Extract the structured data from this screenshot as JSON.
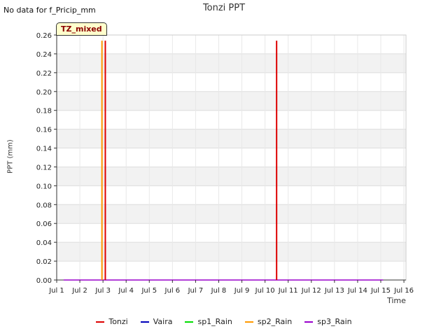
{
  "note": "No data for f_Pricip_mm",
  "badge": "TZ_mixed",
  "chart_data": {
    "type": "line",
    "title": "Tonzi PPT",
    "xlabel": "Time",
    "ylabel": "PPT (mm)",
    "xlim": [
      "2024-07-01",
      "2024-07-16"
    ],
    "ylim": [
      0,
      0.26
    ],
    "x_ticks": [
      "Jul 1",
      "Jul 2",
      "Jul 3",
      "Jul 4",
      "Jul 5",
      "Jul 6",
      "Jul 7",
      "Jul 8",
      "Jul 9",
      "Jul 10",
      "Jul 11",
      "Jul 12",
      "Jul 13",
      "Jul 14",
      "Jul 15",
      "Jul 16"
    ],
    "y_ticks": [
      "0.00",
      "0.02",
      "0.04",
      "0.06",
      "0.08",
      "0.10",
      "0.12",
      "0.14",
      "0.16",
      "0.18",
      "0.20",
      "0.22",
      "0.24",
      "0.26"
    ],
    "grid": true,
    "legend_position": "bottom",
    "series": [
      {
        "name": "Tonzi",
        "color": "#dd0000",
        "x": [
          "Jul 1.3",
          "Jul 3.1",
          "Jul 10.5",
          "Jul 15.1"
        ],
        "y": [
          0,
          0.254,
          0.254,
          0
        ]
      },
      {
        "name": "Vaira",
        "color": "#0000bb",
        "x": [],
        "y": []
      },
      {
        "name": "sp1_Rain",
        "color": "#00dd00",
        "x": [],
        "y": []
      },
      {
        "name": "sp2_Rain",
        "color": "#ff9900",
        "x": [
          "Jul 3.0"
        ],
        "y": [
          0.254
        ]
      },
      {
        "name": "sp3_Rain",
        "color": "#9900cc",
        "x": [
          "Jul 1.3",
          "Jul 15.1"
        ],
        "y": [
          0,
          0
        ]
      }
    ]
  }
}
